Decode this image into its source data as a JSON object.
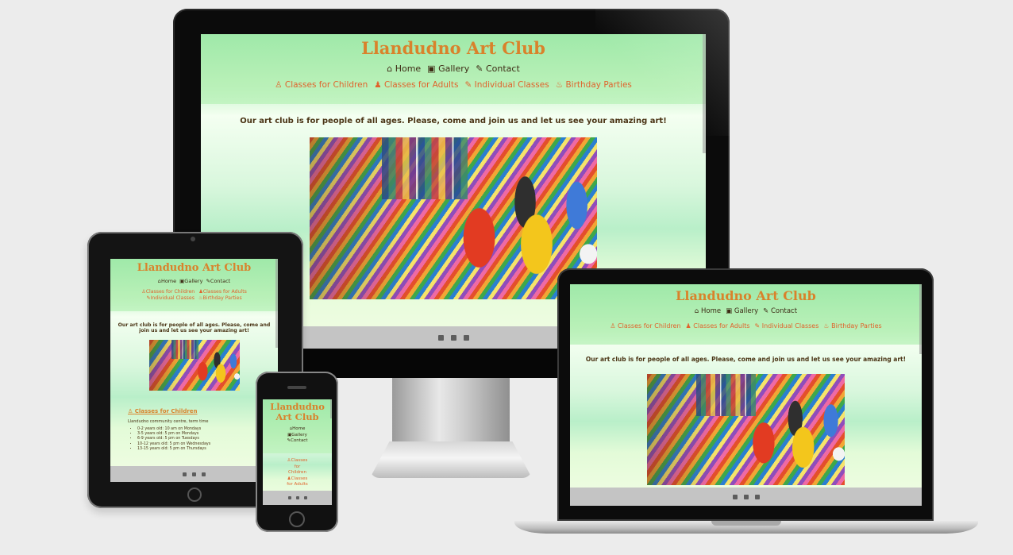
{
  "site": {
    "title": "Llandudno Art Club",
    "nav": [
      {
        "icon": "home-icon",
        "glyph": "⌂",
        "label": "Home"
      },
      {
        "icon": "image-icon",
        "glyph": "▣",
        "label": "Gallery"
      },
      {
        "icon": "pencil-icon",
        "glyph": "✎",
        "label": "Contact"
      }
    ],
    "subnav": [
      {
        "icon": "child-icon",
        "glyph": "♙",
        "label": "Classes for Children"
      },
      {
        "icon": "adult-icon",
        "glyph": "♟",
        "label": "Classes for Adults"
      },
      {
        "icon": "brush-icon",
        "glyph": "✎",
        "label": "Individual Classes"
      },
      {
        "icon": "cake-icon",
        "glyph": "♨",
        "label": "Birthday Parties"
      }
    ],
    "tagline": "Our art club is for people of all ages. Please, come and join us and let us see your amazing art!",
    "photo_alt": "art supplies photo",
    "footer_icons": [
      "facebook-icon",
      "instagram-icon",
      "twitter-icon"
    ],
    "classes": {
      "heading": "Classes for Children",
      "location": "Llandudno community centre, term time",
      "items": [
        "0-2 years old: 10 am on Mondays",
        "3-5 years old: 5 pm on Mondays",
        "6-9 years old: 5 pm on Tuesdays",
        "10-12 years old: 5 pm on Wednesdays",
        "13-15 years old: 5 pm on Thursdays"
      ]
    },
    "phone_title_lines": [
      "Llandudno",
      "Art Club"
    ],
    "phone_subnav_lines": [
      "Classes",
      "for",
      "Children",
      "Classes",
      "for Adults"
    ]
  },
  "colors": {
    "title": "#d9822b",
    "subnav": "#e0632c",
    "text": "#4a3415",
    "footer": "#c4c4c4"
  }
}
